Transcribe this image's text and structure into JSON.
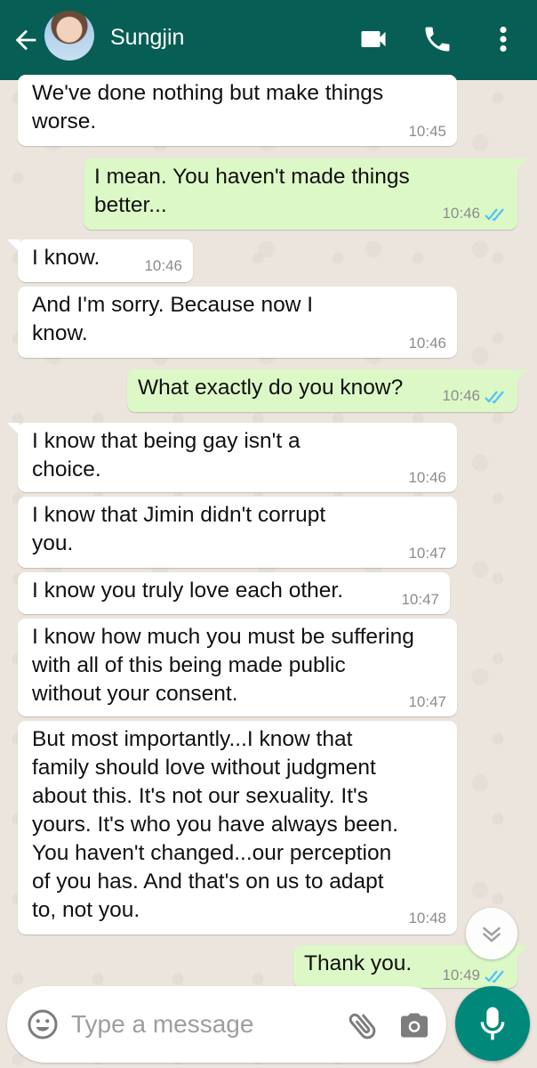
{
  "header": {
    "contact_name": "Sungjin",
    "icons": [
      "back-arrow-icon",
      "video-call-icon",
      "phone-icon",
      "more-vert-icon"
    ]
  },
  "messages": [
    {
      "direction": "in",
      "text": "We've done nothing but make things\nworse.",
      "time": "10:45"
    },
    {
      "direction": "out",
      "text": "I mean. You haven't made things\nbetter...",
      "time": "10:46",
      "status": "read"
    },
    {
      "direction": "in",
      "text": "I know.",
      "time": "10:46"
    },
    {
      "direction": "in",
      "text": "And I'm sorry. Because now I\nknow.",
      "time": "10:46"
    },
    {
      "direction": "out",
      "text": "What exactly do you know?",
      "time": "10:46",
      "status": "read"
    },
    {
      "direction": "in",
      "text": "I know that being gay isn't a\nchoice.",
      "time": "10:46"
    },
    {
      "direction": "in",
      "text": "I know that Jimin didn't corrupt\nyou.",
      "time": "10:47"
    },
    {
      "direction": "in",
      "text": "I know you truly love each other.",
      "time": "10:47"
    },
    {
      "direction": "in",
      "text": "I know how much you must be suffering\nwith all of this being made public\nwithout your consent.",
      "time": "10:47"
    },
    {
      "direction": "in",
      "text": "But most importantly...I know that\nfamily should love without judgment\nabout this. It's not our sexuality. It's\nyours. It's who you have always been.\nYou haven't changed...our perception\nof you has. And that's on us to adapt\nto, not you.",
      "time": "10:48"
    },
    {
      "direction": "out",
      "text": "Thank you.",
      "time": "10:49",
      "status": "read"
    }
  ],
  "composer": {
    "placeholder": "Type a message",
    "value": ""
  },
  "colors": {
    "header": "#075e54",
    "outgoing_bubble": "#dcf8c6",
    "incoming_bubble": "#ffffff",
    "read_ticks": "#4fc3f7",
    "mic_button": "#00897b",
    "chat_background": "#ece5dd"
  }
}
